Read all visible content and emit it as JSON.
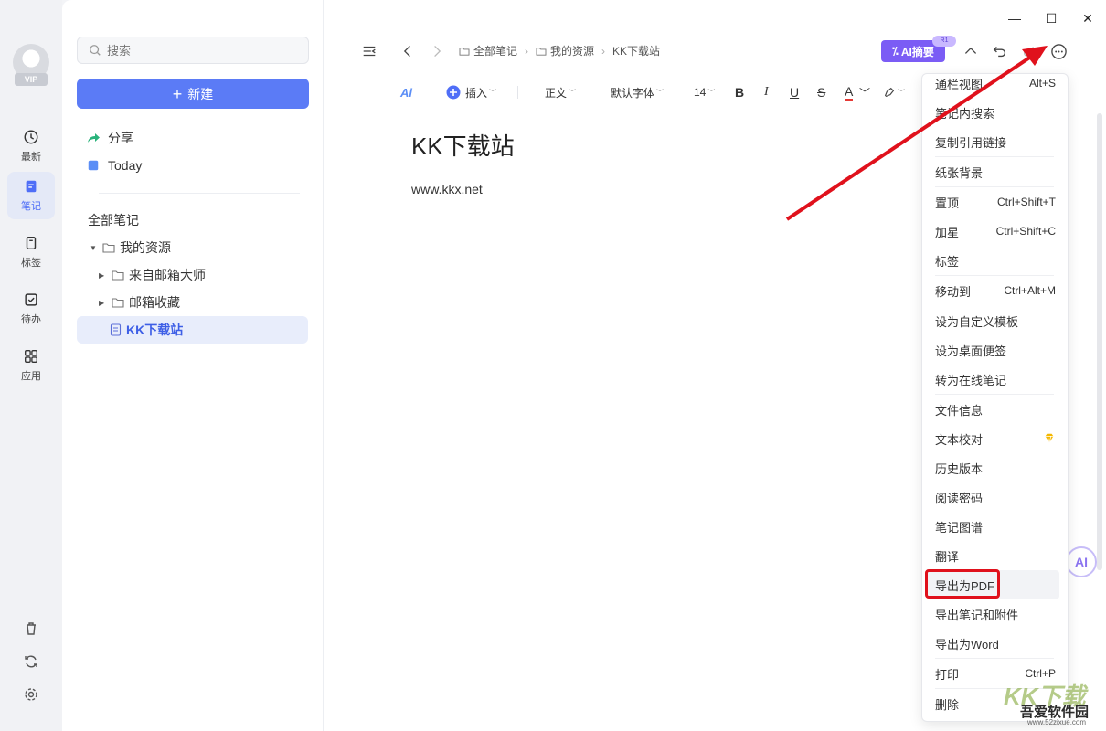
{
  "rail": {
    "vip_label": "VIP",
    "items": [
      {
        "label": "最新",
        "icon": "clock-icon"
      },
      {
        "label": "笔记",
        "icon": "note-icon"
      },
      {
        "label": "标签",
        "icon": "bookmark-icon"
      },
      {
        "label": "待办",
        "icon": "checkbox-icon"
      },
      {
        "label": "应用",
        "icon": "apps-icon"
      }
    ],
    "bottom_icons": [
      "trash-icon",
      "sync-icon",
      "settings-icon"
    ]
  },
  "sidebar": {
    "search_placeholder": "搜索",
    "new_label": "新建",
    "share_label": "分享",
    "today_label": "Today",
    "all_notes": "全部笔记",
    "tree": [
      {
        "label": "我的资源"
      },
      {
        "label": "来自邮箱大师"
      },
      {
        "label": "邮箱收藏"
      },
      {
        "label": "KK下载站"
      }
    ]
  },
  "header": {
    "breadcrumb": [
      "全部笔记",
      "我的资源",
      "KK下载站"
    ],
    "ai_summary": "AI摘要",
    "ai_badge": "R1"
  },
  "toolbar": {
    "insert": "插入",
    "paragraph": "正文",
    "font": "默认字体",
    "size": "14",
    "ai_icon_text": "Ai"
  },
  "doc": {
    "title": "KK下载站",
    "body": "www.kkx.net"
  },
  "menu": {
    "items": [
      {
        "label": "通栏视图",
        "shortcut": "Alt+S"
      },
      {
        "label": "笔记内搜索",
        "shortcut": ""
      },
      {
        "label": "复制引用链接",
        "shortcut": ""
      },
      {
        "label": "纸张背景",
        "shortcut": ""
      },
      {
        "label": "置顶",
        "shortcut": "Ctrl+Shift+T"
      },
      {
        "label": "加星",
        "shortcut": "Ctrl+Shift+C"
      },
      {
        "label": "标签",
        "shortcut": ""
      },
      {
        "label": "移动到",
        "shortcut": "Ctrl+Alt+M"
      },
      {
        "label": "设为自定义模板",
        "shortcut": ""
      },
      {
        "label": "设为桌面便签",
        "shortcut": ""
      },
      {
        "label": "转为在线笔记",
        "shortcut": ""
      },
      {
        "label": "文件信息",
        "shortcut": ""
      },
      {
        "label": "文本校对",
        "shortcut": ""
      },
      {
        "label": "历史版本",
        "shortcut": ""
      },
      {
        "label": "阅读密码",
        "shortcut": ""
      },
      {
        "label": "笔记图谱",
        "shortcut": ""
      },
      {
        "label": "翻译",
        "shortcut": ""
      },
      {
        "label": "导出为PDF",
        "shortcut": ""
      },
      {
        "label": "导出笔记和附件",
        "shortcut": ""
      },
      {
        "label": "导出为Word",
        "shortcut": ""
      },
      {
        "label": "打印",
        "shortcut": "Ctrl+P"
      },
      {
        "label": "删除",
        "shortcut": ""
      }
    ]
  },
  "ai_float": "AI",
  "watermark": {
    "logo": "KK下载",
    "site": "吾爱软件园",
    "url": "www.52zixue.com"
  },
  "colors": {
    "accent": "#5b7bf6",
    "ai_purple": "#7b5cf5",
    "highlight_red": "#e0111c"
  }
}
